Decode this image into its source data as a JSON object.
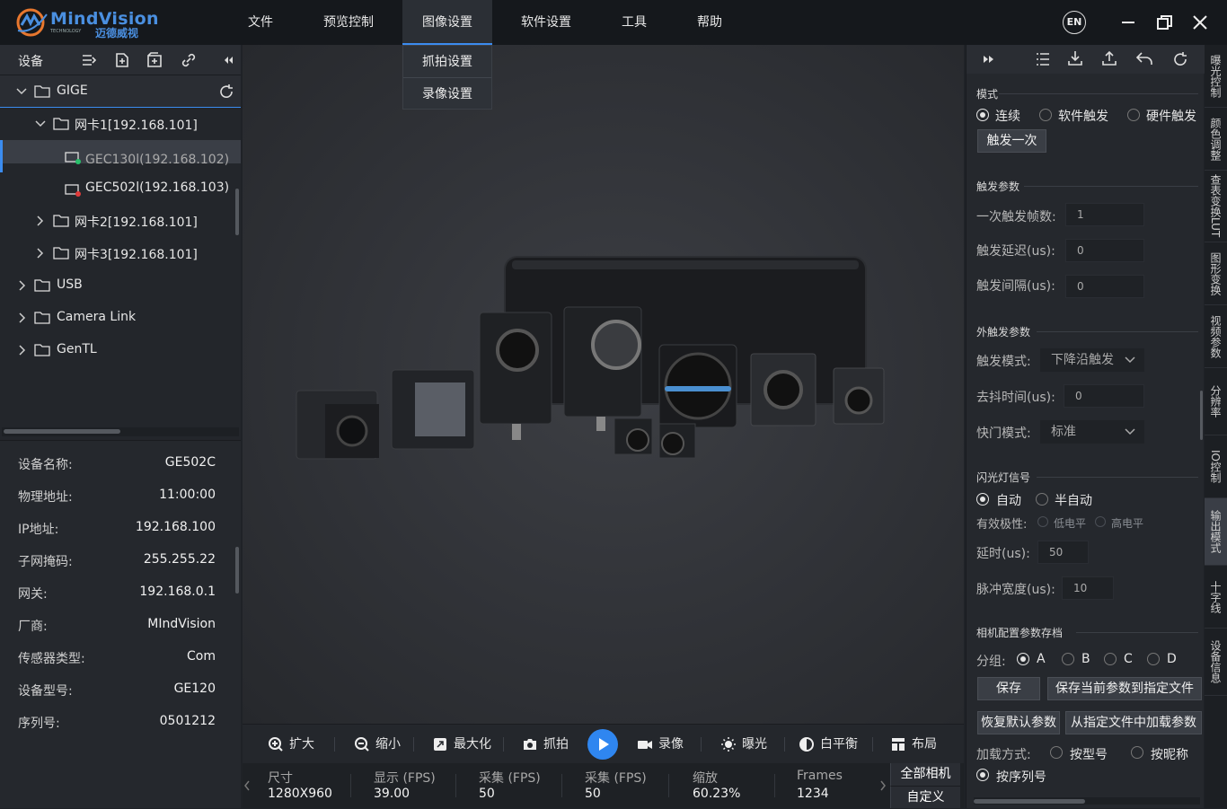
{
  "app": {
    "logo_name": "MindVision",
    "logo_sub": "TECHNOLOGY",
    "logo_cn": "迈德威视"
  },
  "menu": [
    {
      "label": "文件"
    },
    {
      "label": "预览控制"
    },
    {
      "label": "图像设置"
    },
    {
      "label": "软件设置"
    },
    {
      "label": "工具"
    },
    {
      "label": "帮助"
    }
  ],
  "dropdown": [
    "抓拍设置",
    "录像设置"
  ],
  "lang": "EN",
  "device_panel": {
    "title": "设备",
    "tree": [
      {
        "label": "GIGE"
      },
      {
        "label": "网卡1[192.168.101]"
      },
      {
        "label": "GEC130l(192.168.102)"
      },
      {
        "label": "GEC502l(192.168.103)"
      },
      {
        "label": "网卡2[192.168.101]"
      },
      {
        "label": "网卡3[192.168.101]"
      },
      {
        "label": "USB"
      },
      {
        "label": "Camera Link"
      },
      {
        "label": "GenTL"
      }
    ]
  },
  "properties": [
    {
      "k": "设备名称:",
      "v": "GE502C"
    },
    {
      "k": "物理地址:",
      "v": "11:00:00"
    },
    {
      "k": "IP地址:",
      "v": "192.168.100"
    },
    {
      "k": "子网掩码:",
      "v": "255.255.22"
    },
    {
      "k": "网关:",
      "v": "192.168.0.1"
    },
    {
      "k": "厂商:",
      "v": "MIndVision"
    },
    {
      "k": "传感器类型:",
      "v": "Com"
    },
    {
      "k": "设备型号:",
      "v": "GE120"
    },
    {
      "k": "序列号:",
      "v": "0501212"
    }
  ],
  "toolbar": [
    {
      "label": "扩大",
      "icon": "zoom-in-icon"
    },
    {
      "label": "缩小",
      "icon": "zoom-out-icon"
    },
    {
      "label": "最大化",
      "icon": "maximize-icon"
    },
    {
      "label": "抓拍",
      "icon": "camera-icon"
    },
    {
      "label": "录像",
      "icon": "video-icon"
    },
    {
      "label": "曝光",
      "icon": "exposure-icon"
    },
    {
      "label": "白平衡",
      "icon": "white-balance-icon"
    },
    {
      "label": "布局",
      "icon": "layout-icon"
    }
  ],
  "status": [
    {
      "k": "尺寸",
      "v": "1280X960"
    },
    {
      "k": "显示 (FPS)",
      "v": "39.00"
    },
    {
      "k": "采集 (FPS)",
      "v": "50"
    },
    {
      "k": "采集 (FPS)",
      "v": "50"
    },
    {
      "k": "缩放",
      "v": "60.23%"
    },
    {
      "k": "Frames",
      "v": "1234"
    }
  ],
  "cam_buttons": {
    "all": "全部相机",
    "custom": "自定义"
  },
  "right": {
    "mode": {
      "title": "模式",
      "options": [
        "连续",
        "软件触发",
        "硬件触发"
      ],
      "selected": "连续",
      "trigger_once": "触发一次"
    },
    "trigger_params": {
      "title": "触发参数",
      "fields": [
        {
          "k": "一次触发帧数:",
          "v": "1"
        },
        {
          "k": "触发延迟(us):",
          "v": "0"
        },
        {
          "k": "触发间隔(us):",
          "v": "0"
        }
      ]
    },
    "ext_trigger": {
      "title": "外触发参数",
      "mode_label": "触发模式:",
      "mode_value": "下降沿触发",
      "debounce_label": "去抖时间(us):",
      "debounce_value": "0",
      "shutter_label": "快门模式:",
      "shutter_value": "标准"
    },
    "strobe": {
      "title": "闪光灯信号",
      "options": [
        "自动",
        "半自动"
      ],
      "selected": "自动",
      "polarity_label": "有效极性:",
      "polarity_options": [
        "低电平",
        "高电平"
      ],
      "delay_label": "延时(us):",
      "delay_value": "50",
      "pulse_label": "脉冲宽度(us):",
      "pulse_value": "10"
    },
    "config": {
      "title": "相机配置参数存档",
      "group_label": "分组:",
      "groups": [
        "A",
        "B",
        "C",
        "D"
      ],
      "selected": "A",
      "save": "保存",
      "save_to_file": "保存当前参数到指定文件",
      "restore": "恢复默认参数",
      "load_from_file": "从指定文件中加载参数",
      "load_label": "加载方式:",
      "load_options": [
        "按型号",
        "按昵称",
        "按序列号"
      ],
      "load_selected": "按序列号"
    }
  },
  "vtabs": [
    "曝光控制",
    "颜色调整",
    "查表变换LUT",
    "图形变换",
    "视频参数",
    "分辨率",
    "IO控制",
    "输出模式",
    "十字线",
    "设备信息"
  ],
  "vtab_active": "输出模式"
}
